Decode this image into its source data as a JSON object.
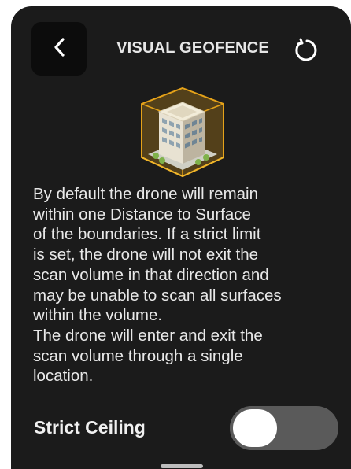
{
  "header": {
    "title": "VISUAL GEOFENCE",
    "back_icon": "chevron-left-icon",
    "reset_icon": "refresh-icon"
  },
  "illustration": {
    "icon": "building-geofence-icon",
    "accent_color": "#e5a219"
  },
  "description": {
    "paragraph_1": "By default the drone will remain\nwithin one Distance to Surface\nof the boundaries. If a strict limit\nis set, the drone will not exit the\nscan volume in that direction and\nmay be unable to scan all surfaces\nwithin the volume.",
    "paragraph_2": "The drone will enter and exit the\nscan volume through a single\nlocation."
  },
  "strict_ceiling": {
    "label": "Strict Ceiling",
    "enabled": false
  }
}
